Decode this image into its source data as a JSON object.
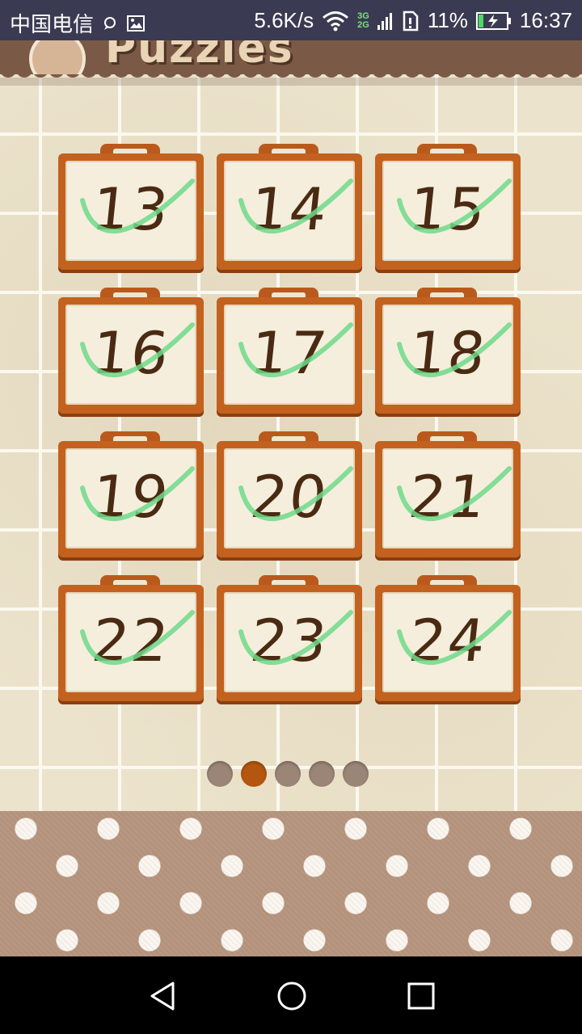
{
  "status_bar": {
    "carrier": "中国电信",
    "net_speed": "5.6K/s",
    "net_type_top": "3G",
    "net_type_bottom": "2G",
    "battery": "11%",
    "time": "16:37"
  },
  "header": {
    "title": "Puzzles"
  },
  "levels": [
    {
      "number": "13",
      "completed": true
    },
    {
      "number": "14",
      "completed": true
    },
    {
      "number": "15",
      "completed": true
    },
    {
      "number": "16",
      "completed": true
    },
    {
      "number": "17",
      "completed": true
    },
    {
      "number": "18",
      "completed": true
    },
    {
      "number": "19",
      "completed": true
    },
    {
      "number": "20",
      "completed": true
    },
    {
      "number": "21",
      "completed": true
    },
    {
      "number": "22",
      "completed": true
    },
    {
      "number": "23",
      "completed": true
    },
    {
      "number": "24",
      "completed": true
    }
  ],
  "pager": {
    "page_count": 5,
    "active_index": 1
  },
  "colors": {
    "card_frame": "#c3611f",
    "card_face": "#f5eedc",
    "number_ink": "#4a2a12",
    "check_mark": "#6fd98a",
    "pager_active": "#b4560f",
    "pager_inactive": "#9a8577",
    "status_bar": "#3a3b52"
  },
  "icons": {
    "status_left": [
      "chat-bubble-icon",
      "image-icon"
    ],
    "status_right": [
      "wifi-icon",
      "signal-icon",
      "sim-icon",
      "battery-charging-icon"
    ],
    "nav": [
      "back-triangle-icon",
      "home-circle-icon",
      "recents-square-icon"
    ]
  }
}
